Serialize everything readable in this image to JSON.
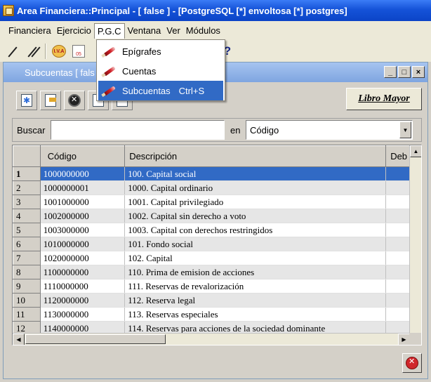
{
  "window": {
    "title": "Area Financiera::Principal  - [ false ] - [PostgreSQL [*] envoltosa [*] postgres]"
  },
  "menubar": {
    "items": [
      {
        "label": "Financiera"
      },
      {
        "label": "Ejercicio"
      },
      {
        "label": "P.G.C"
      },
      {
        "label": "Ventana"
      },
      {
        "label": "Ver"
      },
      {
        "label": "Módulos"
      }
    ],
    "open_menu": "P.G.C"
  },
  "toolbar": {
    "icons": [
      "pen-icon",
      "double-pen-icon",
      "iva-icon",
      "calendar-icon",
      "help-icon"
    ],
    "iva_text": "I.V.A",
    "calendar_text": "05",
    "help_glyph": "?"
  },
  "pgc_menu": {
    "items": [
      {
        "label": "Epígrafes",
        "shortcut": ""
      },
      {
        "label": "Cuentas",
        "shortcut": ""
      },
      {
        "label": "Subcuentas",
        "shortcut": "Ctrl+S"
      }
    ],
    "selected": "Subcuentas"
  },
  "child_window": {
    "title": "Subcuentas [ fals",
    "libro_mayor_label": "Libro Mayor",
    "min_glyph": "_",
    "max_glyph": "□",
    "close_glyph": "×"
  },
  "search": {
    "label": "Buscar",
    "value": "",
    "en_label": "en",
    "field_selected": "Código"
  },
  "table": {
    "columns": [
      "Código",
      "Descripción",
      "Deb"
    ],
    "rows": [
      {
        "n": "1",
        "codigo": "1000000000",
        "descripcion": "100. Capital social"
      },
      {
        "n": "2",
        "codigo": "1000000001",
        "descripcion": "1000. Capital ordinario"
      },
      {
        "n": "3",
        "codigo": "1001000000",
        "descripcion": "1001. Capital privilegiado"
      },
      {
        "n": "4",
        "codigo": "1002000000",
        "descripcion": "1002. Capital sin derecho a voto"
      },
      {
        "n": "5",
        "codigo": "1003000000",
        "descripcion": "1003. Capital con derechos restringidos"
      },
      {
        "n": "6",
        "codigo": "1010000000",
        "descripcion": "101. Fondo social"
      },
      {
        "n": "7",
        "codigo": "1020000000",
        "descripcion": "102. Capital"
      },
      {
        "n": "8",
        "codigo": "1100000000",
        "descripcion": "110. Prima de emision de acciones"
      },
      {
        "n": "9",
        "codigo": "1110000000",
        "descripcion": "111. Reservas de revalorización"
      },
      {
        "n": "10",
        "codigo": "1120000000",
        "descripcion": "112. Reserva legal"
      },
      {
        "n": "11",
        "codigo": "1130000000",
        "descripcion": "113. Reservas especiales"
      },
      {
        "n": "12",
        "codigo": "1140000000",
        "descripcion": "114. Reservas para acciones de la sociedad dominante"
      }
    ],
    "selected_row": "1"
  }
}
